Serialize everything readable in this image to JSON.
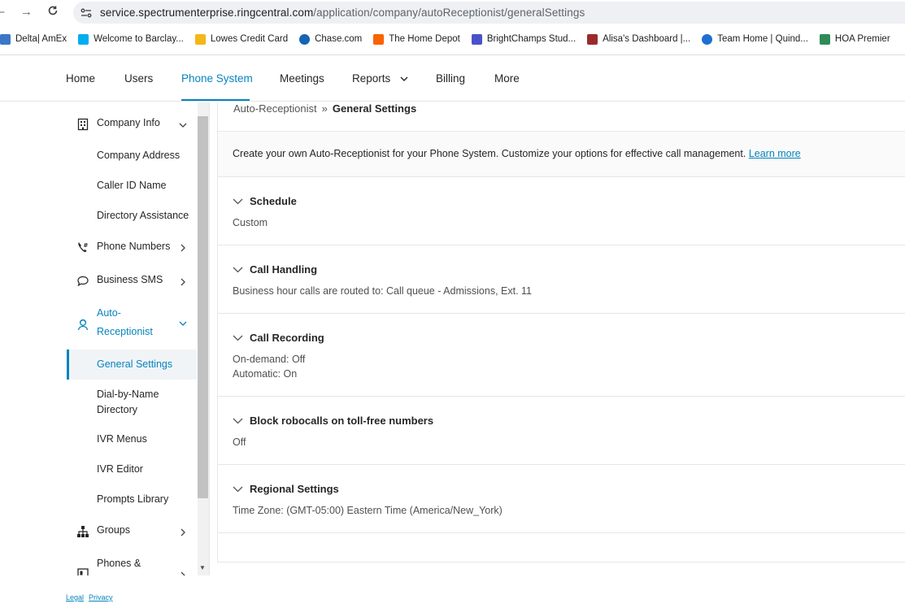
{
  "browser": {
    "url_host": "service.spectrumenterprise.ringcentral.com",
    "url_path": "/application/company/autoReceptionist/generalSettings",
    "bookmarks": [
      {
        "label": "Delta| AmEx",
        "color": "#3b77c7",
        "icon": "card-icon"
      },
      {
        "label": "Welcome to Barclay...",
        "color": "#00aeef",
        "icon": "eagle-icon"
      },
      {
        "label": "Lowes Credit Card",
        "color": "#f3b71b",
        "icon": "bars-icon"
      },
      {
        "label": "Chase.com",
        "color": "#1465b3",
        "icon": "octagon-icon"
      },
      {
        "label": "The Home Depot",
        "color": "#f96302",
        "icon": "homedepot-icon"
      },
      {
        "label": "BrightChamps Stud...",
        "color": "#4a52c9",
        "icon": "shield-icon"
      },
      {
        "label": "Alisa's Dashboard |...",
        "color": "#9b2b2b",
        "icon": "book-icon"
      },
      {
        "label": "Team Home | Quind...",
        "color": "#1f6fd1",
        "icon": "q-icon"
      },
      {
        "label": "HOA Premier",
        "color": "#2e8b57",
        "icon": "check-icon"
      }
    ]
  },
  "header": {
    "nav": [
      {
        "label": "Home"
      },
      {
        "label": "Users"
      },
      {
        "label": "Phone System",
        "active": true
      },
      {
        "label": "Meetings"
      },
      {
        "label": "Reports"
      },
      {
        "label": "Billing"
      },
      {
        "label": "More"
      }
    ],
    "accent": "#0684bd"
  },
  "sidebar": {
    "items": [
      {
        "label": "Company Info"
      },
      {
        "label": "Company Address"
      },
      {
        "label": "Caller ID Name"
      },
      {
        "label": "Directory Assistance"
      },
      {
        "label": "Phone Numbers"
      },
      {
        "label": "Business SMS"
      },
      {
        "label": "Auto-"
      },
      {
        "label": "Receptionist"
      },
      {
        "label": "General Settings",
        "active": true
      },
      {
        "label": "Dial-by-Name"
      },
      {
        "label": "Directory"
      },
      {
        "label": "IVR Menus"
      },
      {
        "label": "IVR Editor"
      },
      {
        "label": "Prompts Library"
      },
      {
        "label": "Groups"
      },
      {
        "label": "Phones &"
      }
    ]
  },
  "main": {
    "breadcrumb": {
      "parent": "Auto-Receptionist",
      "separator": "»",
      "current": "General Settings"
    },
    "intro": {
      "text": "Create your own Auto-Receptionist for your Phone System. Customize your options for effective call management.",
      "link": "Learn more"
    },
    "sections": [
      {
        "title": "Schedule",
        "lines": [
          "Custom"
        ]
      },
      {
        "title": "Call Handling",
        "lines": [
          "Business hour calls are routed to: Call queue - Admissions, Ext. 11"
        ]
      },
      {
        "title": "Call Recording",
        "lines": [
          "On-demand: Off",
          "Automatic: On"
        ]
      },
      {
        "title": "Block robocalls on toll-free numbers",
        "lines": [
          "Off"
        ]
      },
      {
        "title": "Regional Settings",
        "lines": [
          "Time Zone: (GMT-05:00) Eastern Time (America/New_York)"
        ]
      }
    ]
  },
  "footer": {
    "legal": "Legal",
    "privacy": "Privacy"
  }
}
